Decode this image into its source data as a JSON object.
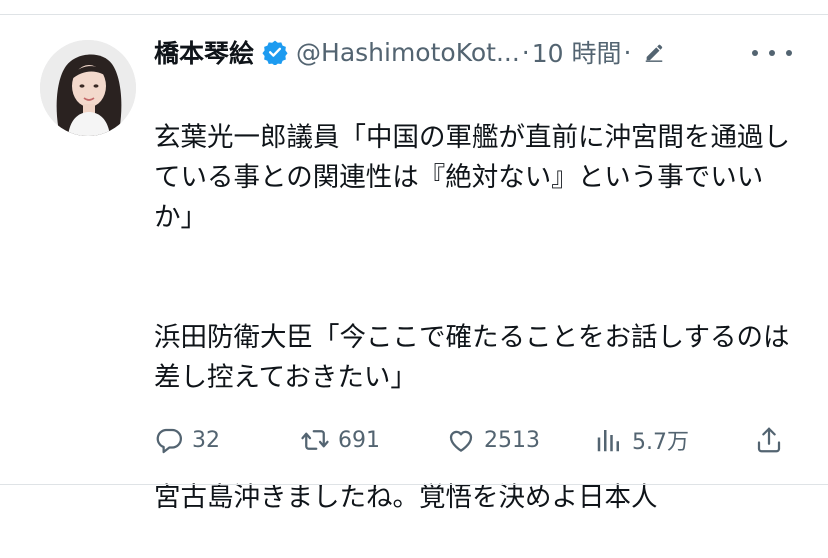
{
  "tweet": {
    "author_name": "橋本琴絵",
    "handle": "@HashimotoKot...",
    "separator": "·",
    "time": "10 時間",
    "paragraphs": [
      "玄葉光一郎議員「中国の軍艦が直前に沖宮間を通過している事との関連性は『絶対ない』という事でいいか」",
      "浜田防衛大臣「今ここで確たることをお話しするのは差し控えておきたい」",
      "宮古島沖きましたね。覚悟を決めよ日本人"
    ],
    "stats": {
      "replies": "32",
      "retweets": "691",
      "likes": "2513",
      "views": "5.7万"
    }
  },
  "colors": {
    "text": "#0f1419",
    "secondary": "#536471",
    "verified": "#1d9bf0",
    "divider": "#dfe3e6"
  },
  "icons": [
    "verified-badge-icon",
    "edit-icon",
    "more-icon",
    "reply-icon",
    "retweet-icon",
    "like-icon",
    "views-icon",
    "share-icon"
  ]
}
